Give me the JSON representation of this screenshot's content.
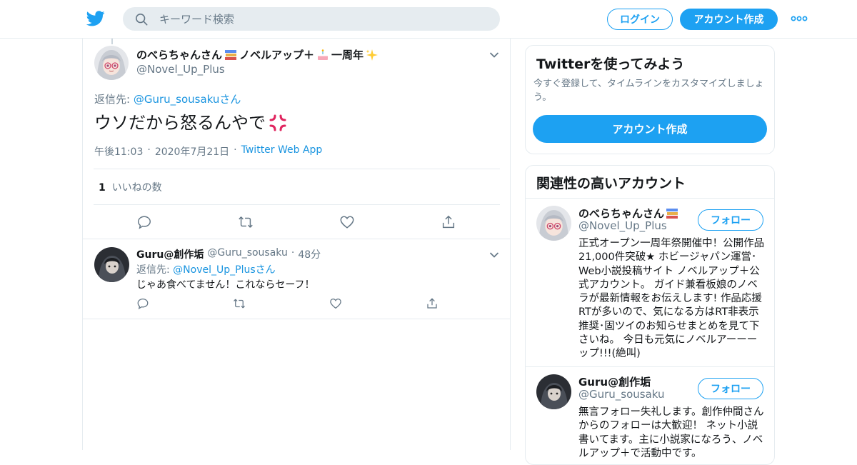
{
  "topbar": {
    "search_placeholder": "キーワード検索",
    "login_label": "ログイン",
    "signup_label": "アカウント作成"
  },
  "tweet": {
    "author_name": "のべらちゃんさん",
    "author_name_suffix": "ノベルアップ＋",
    "author_name_suffix2": "一周年",
    "author_handle": "@Novel_Up_Plus",
    "reply_prefix": "返信先: ",
    "reply_handle": "@Guru_sousaku",
    "reply_suffix": "さん",
    "text": "ウソだから怒るんやで",
    "time": "午後11:03",
    "date": "2020年7月21日",
    "source": "Twitter Web App",
    "like_count": "1",
    "like_label": "いいねの数"
  },
  "reply": {
    "author_name": "Guru@創作垢",
    "author_handle": "@Guru_sousaku",
    "age": "48分",
    "reply_prefix": "返信先: ",
    "reply_handle": "@Novel_Up_Plus",
    "reply_suffix": "さん",
    "text": "じゃあ食べてません！これならセーフ！"
  },
  "signup_card": {
    "title": "Twitterを使ってみよう",
    "description": "今すぐ登録して、タイムラインをカスタマイズしましょう。",
    "button_label": "アカウント作成"
  },
  "related_card": {
    "title": "関連性の高いアカウント",
    "accounts": [
      {
        "name": "のべらちゃんさん",
        "handle": "@Novel_Up_Plus",
        "follow_label": "フォロー",
        "bio": "正式オープン一周年祭開催中！公開作品21,000件突破★ ホビージャパン運営･Web小説投稿サイト ノベルアップ＋公式アカウント。 ガイド兼看板娘のノベラが最新情報をお伝えします! 作品応援RTが多いので、気になる方はRT非表示推奨･固ツイのお知らせまとめを見て下さいね。 今日も元気にノベルアーーーップ!!!(絶叫)"
      },
      {
        "name": "Guru@創作垢",
        "handle": "@Guru_sousaku",
        "follow_label": "フォロー",
        "bio": "無言フォロー失礼します。創作仲間さんからのフォローは大歓迎！ ネット小説書いてます。主に小説家になろう、ノベルアップ＋で活動中です。"
      }
    ]
  },
  "colors": {
    "accent": "#1da1f2",
    "link": "#1b95e0",
    "muted": "#657786",
    "border": "#e6ecf0"
  }
}
